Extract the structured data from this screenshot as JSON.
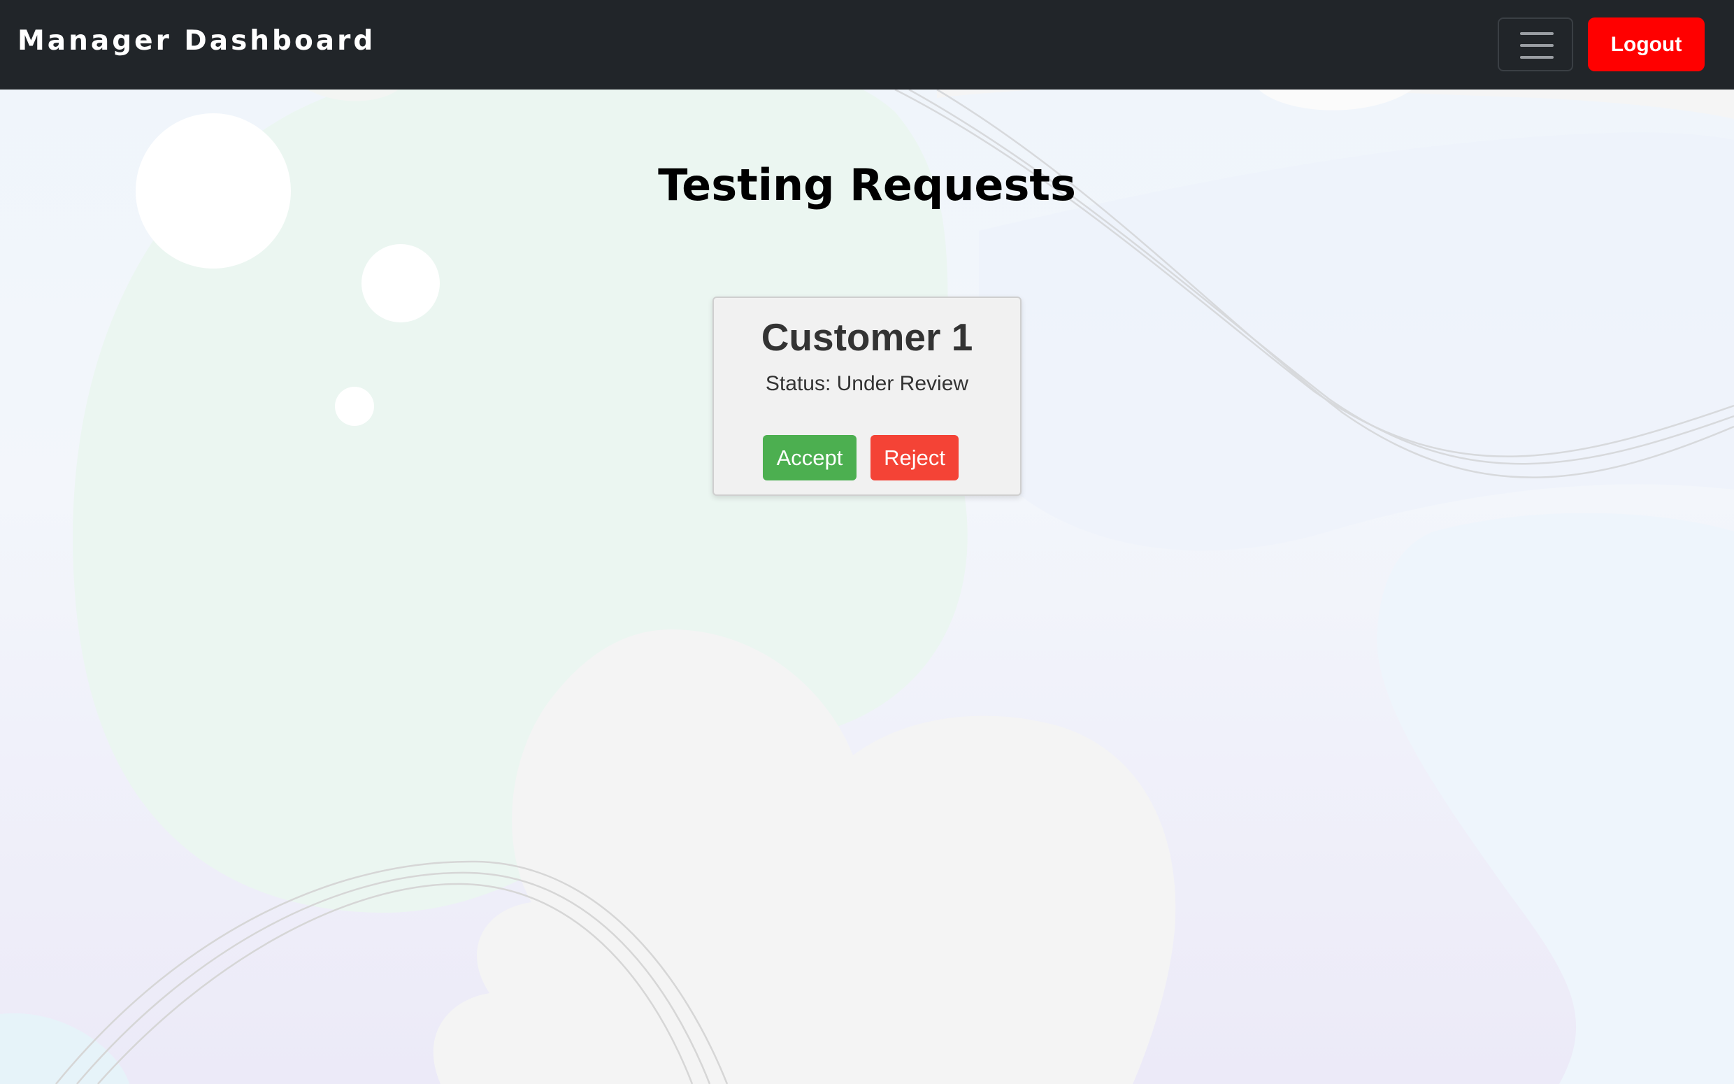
{
  "navbar": {
    "brand": "Manager Dashboard",
    "logout_label": "Logout",
    "menu_icon": "hamburger-menu-icon"
  },
  "main": {
    "title": "Testing Requests",
    "requests": [
      {
        "customer": "Customer 1",
        "status": "Status: Under Review",
        "accept_label": "Accept",
        "reject_label": "Reject"
      }
    ]
  },
  "colors": {
    "navbar_bg": "#212529",
    "logout": "#ff0000",
    "accept": "#4caf50",
    "reject": "#f44336",
    "card_bg": "#f1f1f1"
  }
}
